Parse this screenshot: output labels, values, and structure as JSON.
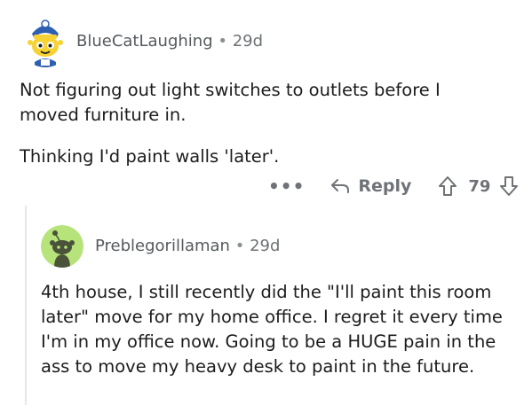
{
  "comment": {
    "username": "BlueCatLaughing",
    "separator": "•",
    "age": "29d",
    "paragraphs": [
      "Not figuring out light switches to outlets before I moved furniture in.",
      "Thinking I'd paint walls 'later'."
    ],
    "actions": {
      "more": "•••",
      "reply_label": "Reply",
      "score": "79"
    }
  },
  "reply": {
    "username": "Preblegorillaman",
    "separator": "•",
    "age": "29d",
    "text": "4th house, I still recently did the \"I'll paint this room later\" move for my home office. I regret it every time I'm in my office now. Going to be a HUGE pain in the ass to move my heavy desk to paint in the future."
  },
  "colors": {
    "avatar2_bg": "#b6e37a",
    "avatar2_snoo": "#4a5239"
  }
}
